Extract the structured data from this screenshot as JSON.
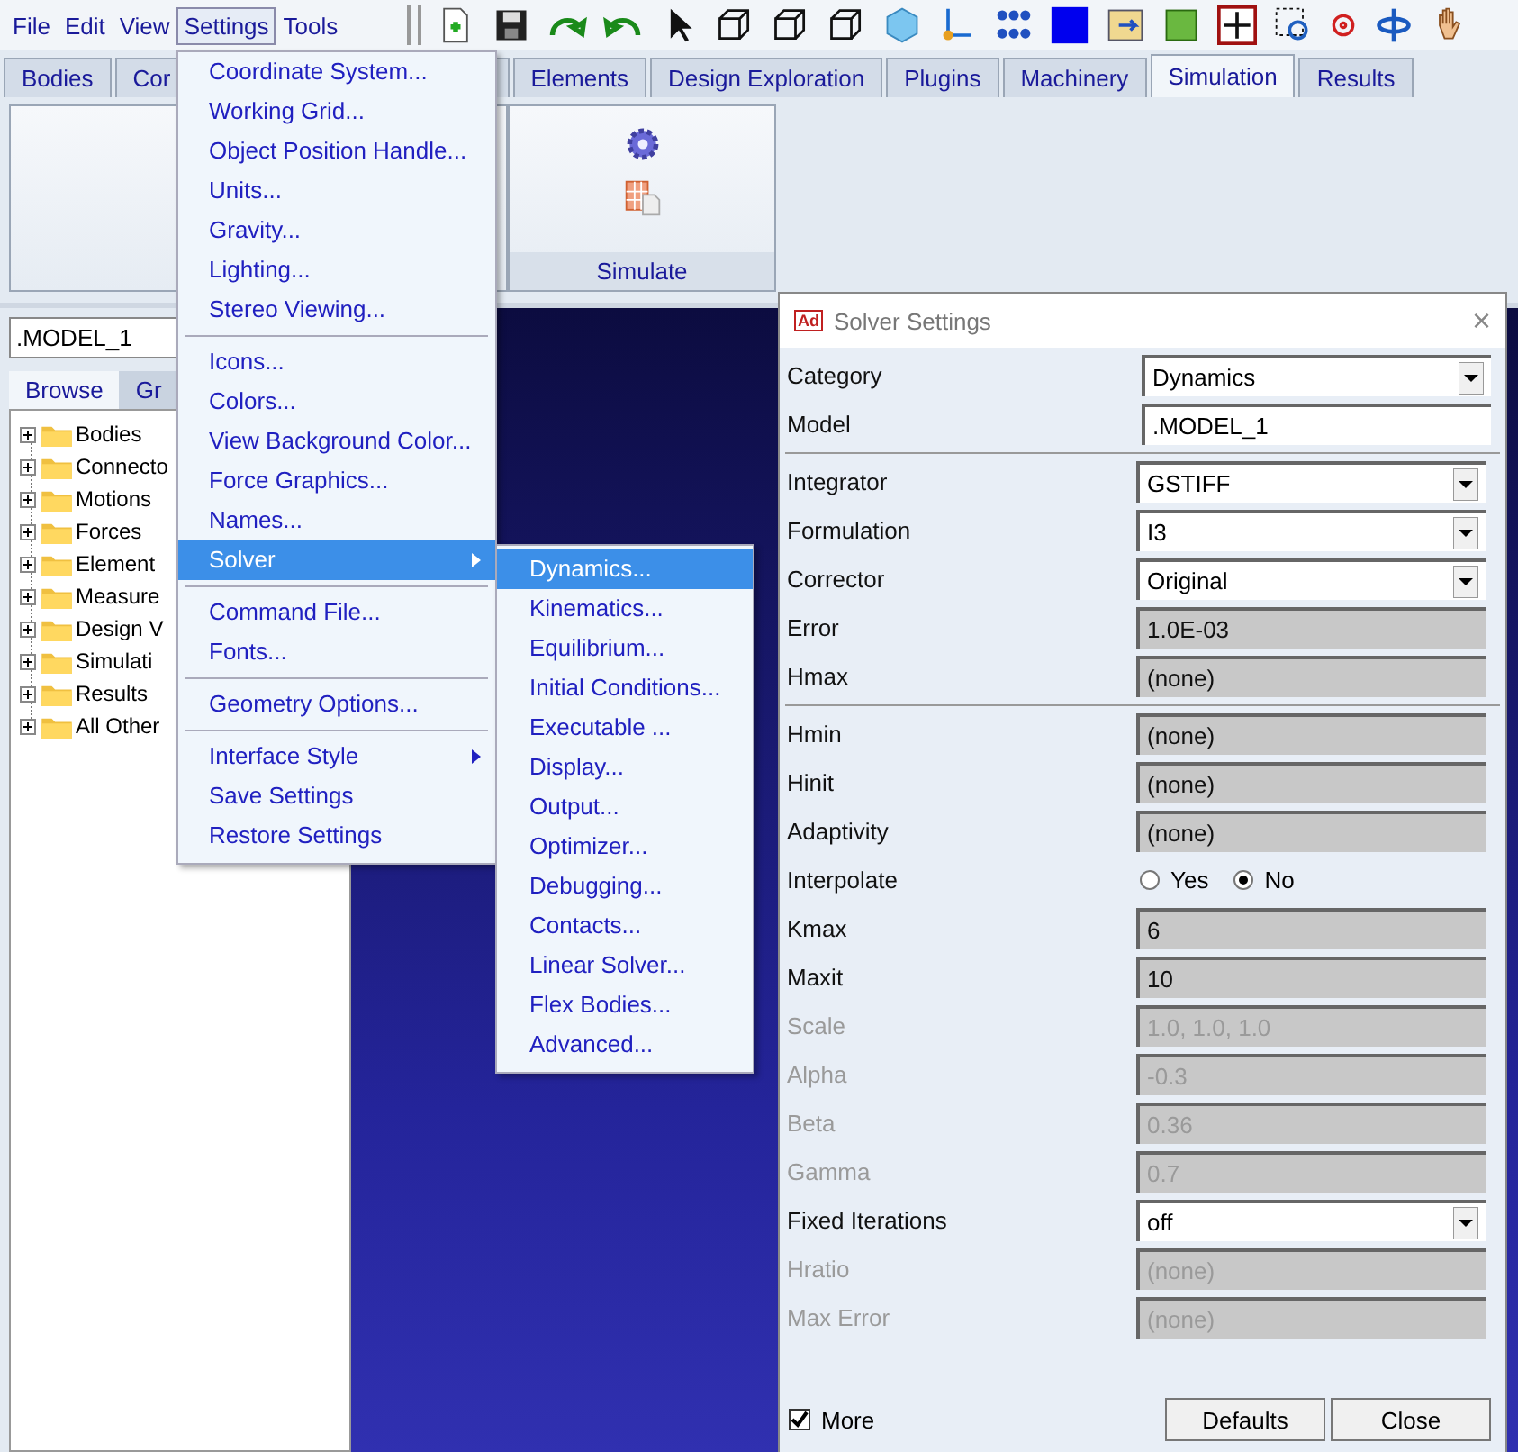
{
  "menubar": [
    {
      "label": "File",
      "selected": false
    },
    {
      "label": "Edit",
      "selected": false
    },
    {
      "label": "View",
      "selected": false
    },
    {
      "label": "Settings",
      "selected": true
    },
    {
      "label": "Tools",
      "selected": false
    }
  ],
  "tabs": [
    {
      "label": "Bodies",
      "selected": false
    },
    {
      "label": "Cor",
      "selected": false
    },
    {
      "label": "Elements",
      "selected": false
    },
    {
      "label": "Design Exploration",
      "selected": false
    },
    {
      "label": "Plugins",
      "selected": false
    },
    {
      "label": "Machinery",
      "selected": false
    },
    {
      "label": "Simulation",
      "selected": true
    },
    {
      "label": "Results",
      "selected": false
    }
  ],
  "ribbon": {
    "group_label": "Simulate"
  },
  "model_field": {
    "value": ".MODEL_1"
  },
  "browser_tabs": [
    {
      "label": "Browse",
      "selected": true
    },
    {
      "label": "Gr",
      "selected": false
    }
  ],
  "tree": [
    {
      "label": "Bodies",
      "expanded": false
    },
    {
      "label": "Connecto",
      "expanded": false
    },
    {
      "label": "Motions",
      "expanded": false
    },
    {
      "label": "Forces",
      "expanded": false
    },
    {
      "label": "Element",
      "expanded": false
    },
    {
      "label": "Measure",
      "expanded": false
    },
    {
      "label": "Design V",
      "expanded": false
    },
    {
      "label": "Simulati",
      "expanded": false
    },
    {
      "label": "Results",
      "expanded": false
    },
    {
      "label": "All Other",
      "expanded": false
    }
  ],
  "settings_menu": {
    "groups": [
      [
        {
          "label": "Coordinate System...",
          "selected": false,
          "submenu": false
        },
        {
          "label": "Working Grid...",
          "selected": false,
          "submenu": false
        },
        {
          "label": "Object Position Handle...",
          "selected": false,
          "submenu": false
        },
        {
          "label": "Units...",
          "selected": false,
          "submenu": false
        },
        {
          "label": "Gravity...",
          "selected": false,
          "submenu": false
        },
        {
          "label": "Lighting...",
          "selected": false,
          "submenu": false
        },
        {
          "label": "Stereo Viewing...",
          "selected": false,
          "submenu": false
        }
      ],
      [
        {
          "label": "Icons...",
          "selected": false,
          "submenu": false
        },
        {
          "label": "Colors...",
          "selected": false,
          "submenu": false
        },
        {
          "label": "View Background Color...",
          "selected": false,
          "submenu": false
        },
        {
          "label": "Force Graphics...",
          "selected": false,
          "submenu": false
        },
        {
          "label": "Names...",
          "selected": false,
          "submenu": false
        },
        {
          "label": "Solver",
          "selected": true,
          "submenu": true
        }
      ],
      [
        {
          "label": "Command File...",
          "selected": false,
          "submenu": false
        },
        {
          "label": "Fonts...",
          "selected": false,
          "submenu": false
        }
      ],
      [
        {
          "label": "Geometry Options...",
          "selected": false,
          "submenu": false
        }
      ],
      [
        {
          "label": "Interface Style",
          "selected": false,
          "submenu": true
        },
        {
          "label": "Save Settings",
          "selected": false,
          "submenu": false
        },
        {
          "label": "Restore Settings",
          "selected": false,
          "submenu": false
        }
      ]
    ]
  },
  "solver_menu": {
    "items": [
      {
        "label": "Dynamics...",
        "selected": true
      },
      {
        "label": "Kinematics...",
        "selected": false
      },
      {
        "label": "Equilibrium...",
        "selected": false
      },
      {
        "label": "Initial Conditions...",
        "selected": false
      },
      {
        "label": "Executable ...",
        "selected": false
      },
      {
        "label": "Display...",
        "selected": false
      },
      {
        "label": "Output...",
        "selected": false
      },
      {
        "label": "Optimizer...",
        "selected": false
      },
      {
        "label": "Debugging...",
        "selected": false
      },
      {
        "label": "Contacts...",
        "selected": false
      },
      {
        "label": "Linear Solver...",
        "selected": false
      },
      {
        "label": "Flex Bodies...",
        "selected": false
      },
      {
        "label": "Advanced...",
        "selected": false
      }
    ]
  },
  "dialog": {
    "badge": "Ad",
    "title": "Solver Settings",
    "close": "×",
    "sections": [
      [
        {
          "label": "Category",
          "kind": "dropdown",
          "value": "Dynamics",
          "disabled": false
        },
        {
          "label": "Model",
          "kind": "text",
          "value": ".MODEL_1",
          "disabled": false
        }
      ],
      [
        {
          "label": "Integrator",
          "kind": "dropdown",
          "value": "GSTIFF",
          "disabled": false
        },
        {
          "label": "Formulation",
          "kind": "dropdown",
          "value": "I3",
          "disabled": false
        },
        {
          "label": "Corrector",
          "kind": "dropdown",
          "value": "Original",
          "disabled": false
        },
        {
          "label": "Error",
          "kind": "readonly",
          "value": "1.0E-03",
          "disabled": false
        },
        {
          "label": "Hmax",
          "kind": "readonly",
          "value": "(none)",
          "disabled": false
        }
      ],
      [
        {
          "label": "Hmin",
          "kind": "readonly",
          "value": "(none)",
          "disabled": false
        },
        {
          "label": "Hinit",
          "kind": "readonly",
          "value": "(none)",
          "disabled": false
        },
        {
          "label": "Adaptivity",
          "kind": "readonly",
          "value": "(none)",
          "disabled": false
        },
        {
          "label": "Interpolate",
          "kind": "radio",
          "options": [
            {
              "label": "Yes",
              "selected": false
            },
            {
              "label": "No",
              "selected": true
            }
          ],
          "disabled": false
        },
        {
          "label": "Kmax",
          "kind": "readonly",
          "value": "6",
          "disabled": false
        },
        {
          "label": "Maxit",
          "kind": "readonly",
          "value": "10",
          "disabled": false
        },
        {
          "label": "Scale",
          "kind": "readonly",
          "value": "1.0, 1.0, 1.0",
          "disabled": true
        },
        {
          "label": "Alpha",
          "kind": "readonly",
          "value": "-0.3",
          "disabled": true
        },
        {
          "label": "Beta",
          "kind": "readonly",
          "value": "0.36",
          "disabled": true
        },
        {
          "label": "Gamma",
          "kind": "readonly",
          "value": "0.7",
          "disabled": true
        },
        {
          "label": "Fixed Iterations",
          "kind": "dropdown",
          "value": "off",
          "disabled": false
        },
        {
          "label": "Hratio",
          "kind": "readonly",
          "value": "(none)",
          "disabled": true
        },
        {
          "label": "Max Error",
          "kind": "readonly",
          "value": "(none)",
          "disabled": true
        }
      ]
    ],
    "more": {
      "label": "More",
      "checked": true
    },
    "buttons": [
      "Defaults",
      "Close"
    ]
  }
}
